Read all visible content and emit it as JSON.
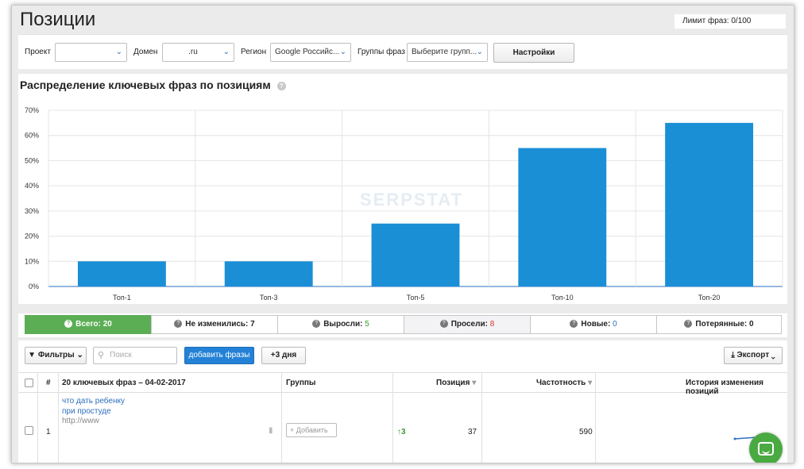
{
  "header": {
    "title": "Позиции",
    "limit": "Лимит фраз: 0/100"
  },
  "toolbar": {
    "project_label": "Проект",
    "project_value": "",
    "domain_label": "Домен",
    "domain_value": ".ru",
    "region_label": "Регион",
    "region_value": "Google Российс...",
    "groups_label": "Группы фраз",
    "groups_value": "Выберите групп...",
    "settings_label": "Настройки"
  },
  "chart_section": {
    "title": "Распределение ключевых фраз по позициям",
    "watermark": "SERPSTAT"
  },
  "chart_data": {
    "type": "bar",
    "categories": [
      "Топ-1",
      "Топ-3",
      "Топ-5",
      "Топ-10",
      "Топ-20"
    ],
    "values": [
      10,
      10,
      25,
      55,
      65
    ],
    "ylim": [
      0,
      70
    ],
    "yticks": [
      "0%",
      "10%",
      "20%",
      "30%",
      "40%",
      "50%",
      "60%",
      "70%"
    ],
    "color": "#1a8fd6",
    "grid": true
  },
  "filters": {
    "all": {
      "label": "Всего:",
      "count": "20"
    },
    "unchanged": {
      "label": "Не изменились:",
      "count": "7"
    },
    "rose": {
      "label": "Выросли:",
      "count": "5"
    },
    "fell": {
      "label": "Просели:",
      "count": "8"
    },
    "new": {
      "label": "Новые:",
      "count": "0"
    },
    "lost": {
      "label": "Потерянные:",
      "count": "0"
    }
  },
  "actions": {
    "filters_label": "Фильтры",
    "search_placeholder": "Поиск",
    "add_phrases_label": "добавить фразы",
    "days_label": "+3 дня",
    "export_label": "Экспорт"
  },
  "table": {
    "headers": {
      "num": "#",
      "keywords": "20 ключевых фраз – 04-02-2017",
      "groups": "Группы",
      "position": "Позиция",
      "frequency": "Частотность",
      "history": "История изменения позиций"
    },
    "rows": [
      {
        "num": "1",
        "keyword_line1": "что дать ребенку",
        "keyword_line2": "при простуде",
        "url": "http://www",
        "add_label": "+ Добавить",
        "change": "↑3",
        "position": "37",
        "frequency": "590"
      }
    ]
  }
}
